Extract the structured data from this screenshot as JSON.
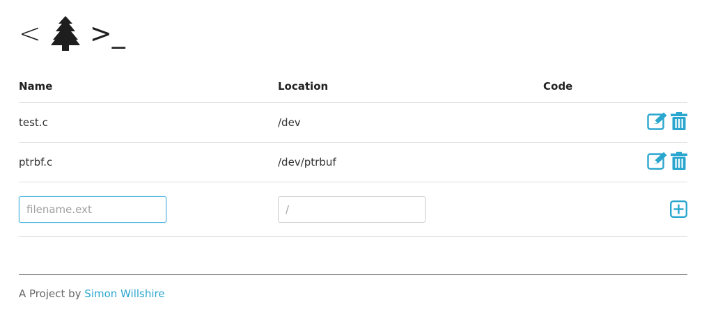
{
  "logo": {
    "open_bracket": "<",
    "icon": "tree-icon",
    "prompt": ">",
    "cursor": "_"
  },
  "table": {
    "headers": {
      "name": "Name",
      "location": "Location",
      "code": "Code"
    },
    "rows": [
      {
        "name": "test.c",
        "location": "/dev",
        "code": ""
      },
      {
        "name": "ptrbf.c",
        "location": "/dev/ptrbuf",
        "code": ""
      }
    ],
    "new_row": {
      "name_placeholder": "filename.ext",
      "location_placeholder": "/"
    }
  },
  "icons": {
    "edit": "edit-icon",
    "delete": "trash-icon",
    "add": "plus-square-icon"
  },
  "colors": {
    "accent": "#2aa6cf",
    "text": "#333333"
  },
  "footer": {
    "prefix": "A Project by ",
    "author": "Simon Willshire"
  }
}
